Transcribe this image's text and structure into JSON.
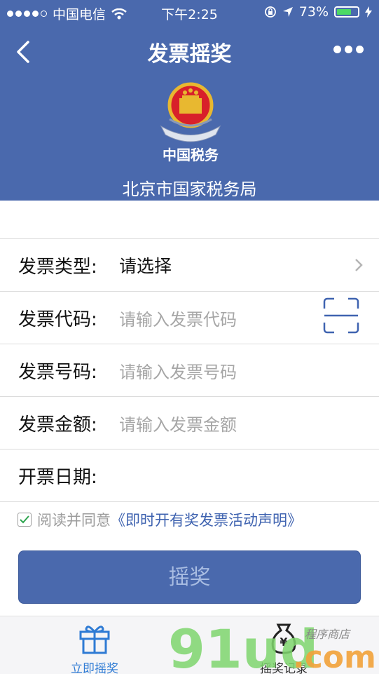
{
  "status_bar": {
    "carrier": "中国电信",
    "time": "下午2:25",
    "battery_percent": "73%",
    "battery_level": 0.73
  },
  "nav": {
    "title": "发票摇奖"
  },
  "header": {
    "emblem_text": "中国税务",
    "bureau": "北京市国家税务局"
  },
  "form": {
    "type": {
      "label": "发票类型:",
      "value": "请选择"
    },
    "code": {
      "label": "发票代码:",
      "placeholder": "请输入发票代码"
    },
    "number": {
      "label": "发票号码:",
      "placeholder": "请输入发票号码"
    },
    "amount": {
      "label": "发票金额:",
      "placeholder": "请输入发票金额"
    },
    "date": {
      "label": "开票日期:"
    }
  },
  "agreement": {
    "checked": true,
    "text": "阅读并同意",
    "link": "《即时开有奖发票活动声明》"
  },
  "submit": {
    "label": "摇奖"
  },
  "tabs": [
    {
      "label": "立即摇奖",
      "icon": "gift-icon",
      "active": true
    },
    {
      "label": "摇奖记录",
      "icon": "money-bag-icon",
      "active": false
    }
  ],
  "watermark": {
    "brand": "91ud.com",
    "subtitle": "程序商店"
  },
  "colors": {
    "primary": "#4a69ad",
    "tab_active": "#2f7bd4",
    "battery": "#4cd964",
    "link": "#3f63b0"
  }
}
